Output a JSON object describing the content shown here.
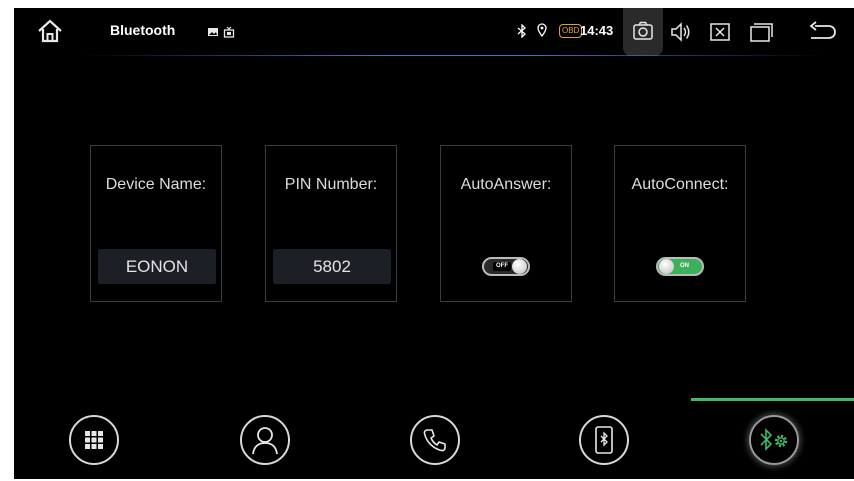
{
  "statusbar": {
    "title": "Bluetooth",
    "obd_badge": "OBD",
    "time": "14:43"
  },
  "settings": [
    {
      "label": "Device Name:",
      "value": "EONON"
    },
    {
      "label": "PIN Number:",
      "value": "5802"
    },
    {
      "label": "AutoAnswer:",
      "toggle": "OFF"
    },
    {
      "label": "AutoConnect:",
      "toggle": "ON"
    }
  ],
  "bottom_nav": {
    "items": [
      "keypad-icon",
      "contacts-icon",
      "phone-icon",
      "bluetooth-device-icon",
      "bluetooth-settings-icon"
    ],
    "active_index": 4
  },
  "colors": {
    "accent_green": "#3fb86a",
    "status_line": "#4682dc",
    "obd_orange": "#e0a030"
  }
}
